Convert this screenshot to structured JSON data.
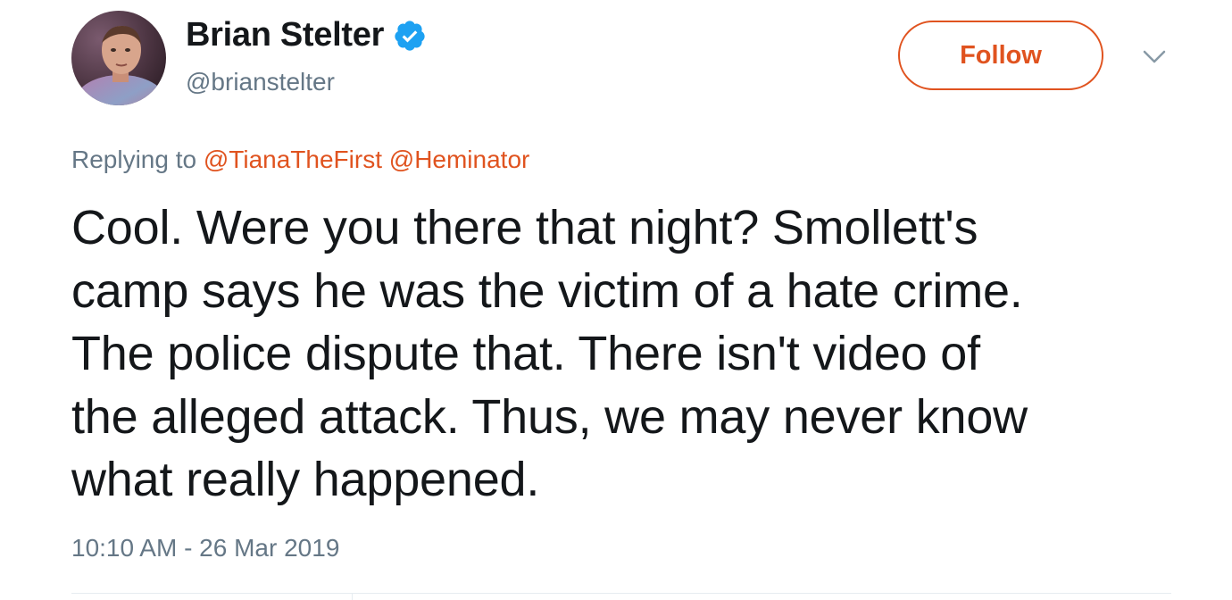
{
  "author": {
    "display_name": "Brian Stelter",
    "handle": "@brianstelter",
    "verified_icon": "verified-badge-icon"
  },
  "actions": {
    "follow_label": "Follow",
    "more_icon": "chevron-down-icon"
  },
  "reply": {
    "prefix": "Replying to",
    "mentions": [
      "@TianaTheFirst",
      "@Heminator"
    ]
  },
  "tweet": {
    "lines": [
      "Cool. Were you there that night? Smollett's",
      "camp says he was the victim of a hate crime.",
      "The police dispute that. There isn't video of",
      "the alleged attack. Thus, we may never know",
      "what really happened."
    ],
    "timestamp": "10:10 AM - 26 Mar 2019"
  },
  "colors": {
    "accent": "#e0531f",
    "verified": "#1da1f2",
    "secondary_text": "#657786",
    "primary_text": "#14171a"
  }
}
